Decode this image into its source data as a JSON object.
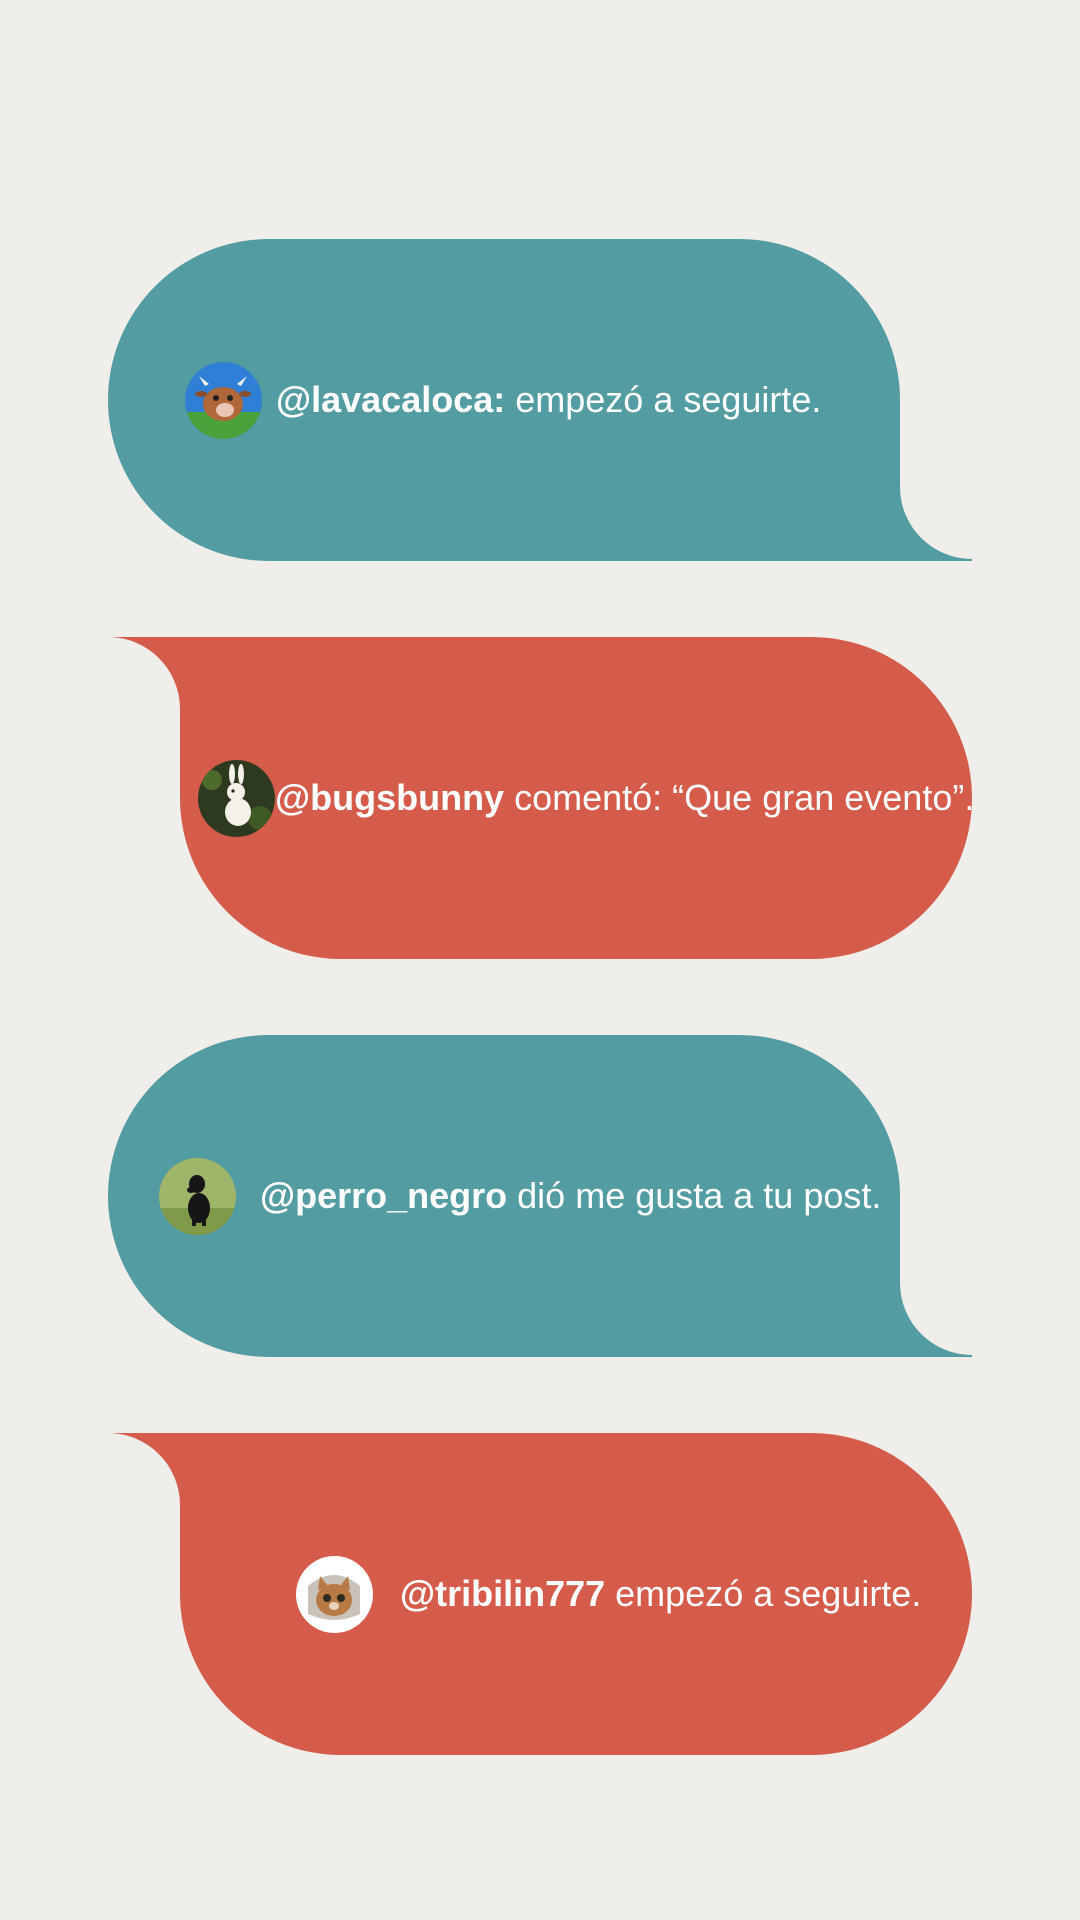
{
  "notifications": [
    {
      "handle": "@lavacaloca:",
      "message": "empezó a seguirte.",
      "avatar_icon": "cow-avatar-icon",
      "color": "#539ca2"
    },
    {
      "handle": "@bugsbunny",
      "message": "comentó: “Que gran evento”.",
      "avatar_icon": "rabbit-avatar-icon",
      "color": "#d55b4a"
    },
    {
      "handle": "@perro_negro",
      "message": "dió me gusta a tu post.",
      "avatar_icon": "dog-avatar-icon",
      "color": "#539ca2"
    },
    {
      "handle": "@tribilin777",
      "message": "empezó a seguirte.",
      "avatar_icon": "cat-avatar-icon",
      "color": "#d55b4a"
    }
  ],
  "colors": {
    "background": "#efeeea",
    "teal": "#539ca2",
    "coral": "#d55b4a",
    "text": "#ffffff"
  }
}
